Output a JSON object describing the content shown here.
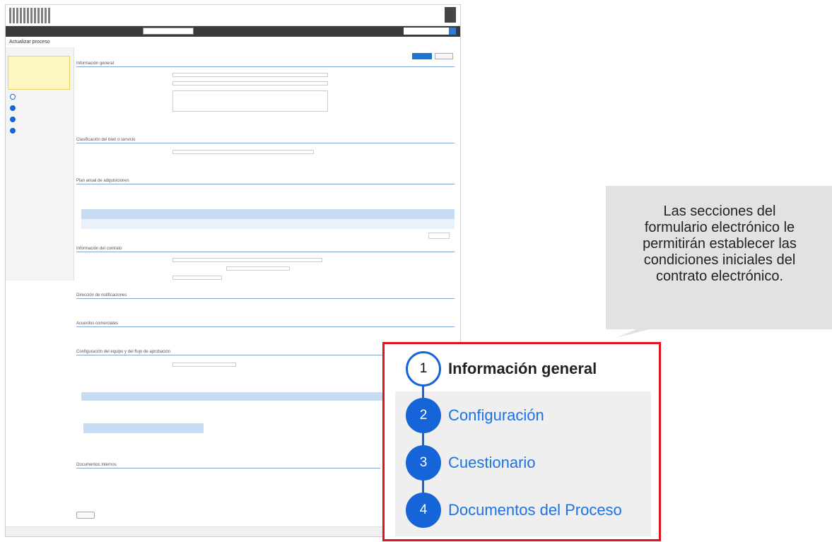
{
  "screenshot": {
    "breadcrumb_tail": "Actualizar proceso",
    "sections": [
      {
        "title": "Información general"
      },
      {
        "title": "Clasificación del bien o servicio"
      },
      {
        "title": "Plan anual de adquisiciones"
      },
      {
        "title": "Información del contrato"
      },
      {
        "title": "Dirección de notificaciones"
      },
      {
        "title": "Acuerdos comerciales"
      },
      {
        "title": "Configuración del equipo y del flujo de aprobación"
      },
      {
        "title": "Documentos internos"
      }
    ]
  },
  "callout": {
    "lines": [
      "Las secciones del",
      "formulario electrónico le",
      "permitirán establecer las",
      "condiciones iniciales del",
      "contrato electrónico."
    ]
  },
  "steps": [
    {
      "number": "1",
      "label": "Información general",
      "active": true
    },
    {
      "number": "2",
      "label": "Configuración",
      "active": false
    },
    {
      "number": "3",
      "label": "Cuestionario",
      "active": false
    },
    {
      "number": "4",
      "label": "Documentos del Proceso",
      "active": false
    }
  ],
  "colors": {
    "accent_blue": "#1565d8",
    "highlight_red": "#e3131b",
    "callout_grey": "#e2e2e2"
  }
}
